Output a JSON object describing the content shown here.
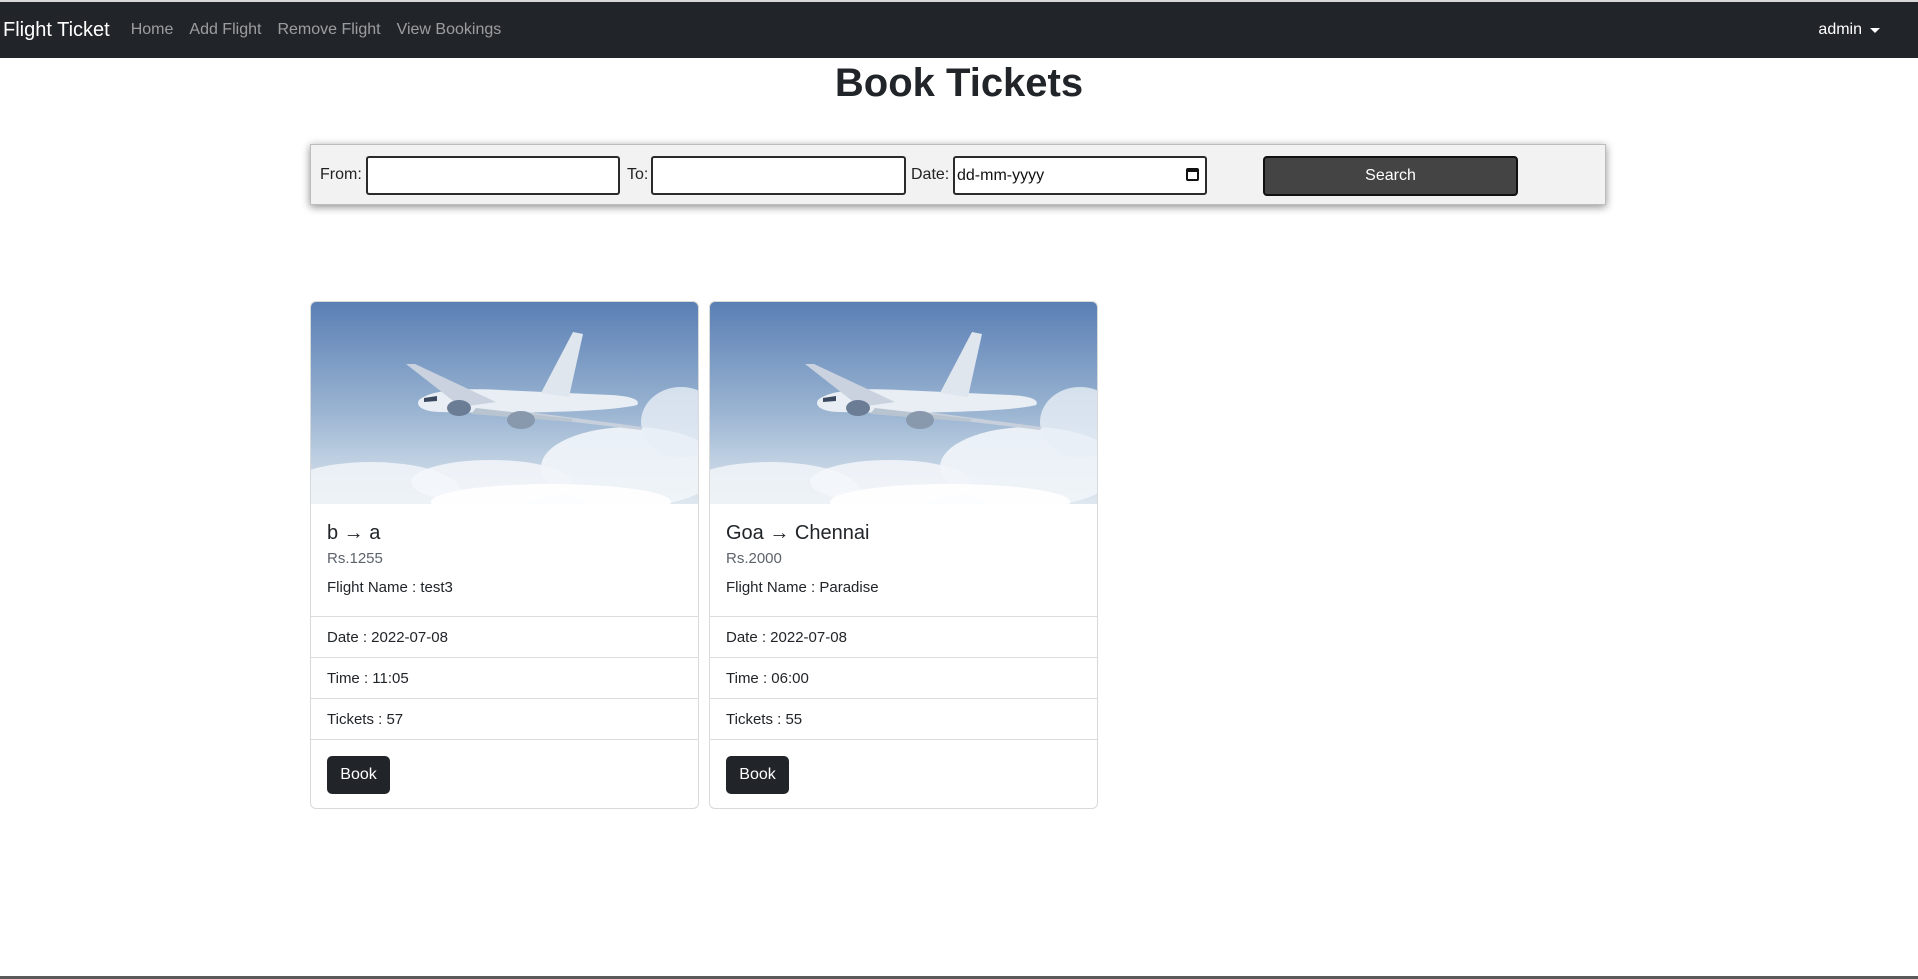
{
  "navbar": {
    "brand": "Flight Ticket",
    "links": [
      "Home",
      "Add Flight",
      "Remove Flight",
      "View Bookings"
    ],
    "user": "admin"
  },
  "page": {
    "title": "Book Tickets"
  },
  "search": {
    "from_label": "From:",
    "from_value": "",
    "to_label": "To:",
    "to_value": "",
    "date_label": "Date:",
    "date_placeholder": "dd-mm-yyyy",
    "button_label": "Search"
  },
  "flights": [
    {
      "title": "b → a",
      "price": "Rs.1255",
      "flight_name": "Flight Name : test3",
      "date": "Date : 2022-07-08",
      "time": "Time : 11:05",
      "tickets": "Tickets : 57",
      "book_label": "Book"
    },
    {
      "title": "Goa → Chennai",
      "price": "Rs.2000",
      "flight_name": "Flight Name : Paradise",
      "date": "Date : 2022-07-08",
      "time": "Time : 06:00",
      "tickets": "Tickets : 55",
      "book_label": "Book"
    }
  ],
  "icons": {
    "dropdown": "chevron-down-icon",
    "calendar": "calendar-icon",
    "airplane_image": "airplane-photo"
  }
}
